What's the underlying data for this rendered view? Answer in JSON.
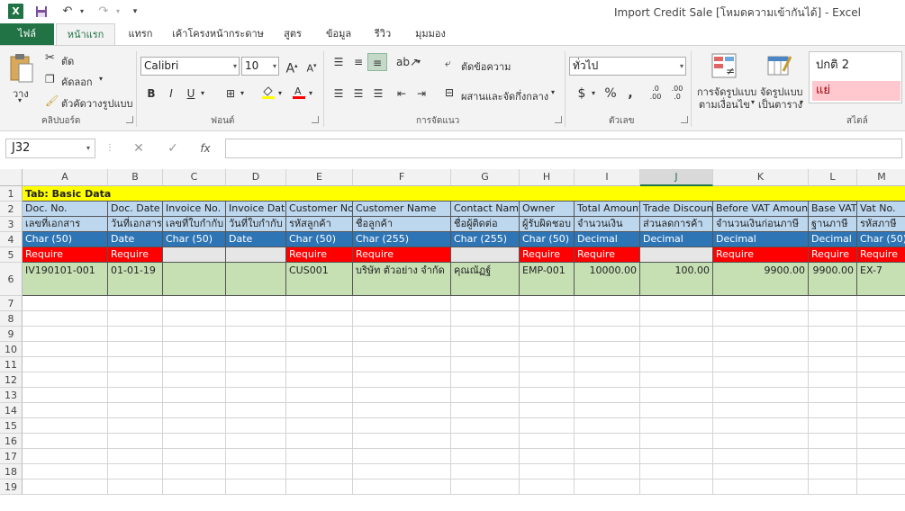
{
  "window": {
    "title": "Import Credit Sale  [โหมดความเข้ากันได้] - Excel",
    "app_icon": "X",
    "qa_save_icon": "save-icon",
    "qa_undo_icon": "undo-icon",
    "qa_redo_icon": "redo-icon"
  },
  "tabs": {
    "file": "ไฟล์",
    "items": [
      "หน้าแรก",
      "แทรก",
      "เค้าโครงหน้ากระดาษ",
      "สูตร",
      "ข้อมูล",
      "รีวิว",
      "มุมมอง"
    ]
  },
  "ribbon": {
    "clipboard": {
      "paste": "วาง",
      "cut": "ตัด",
      "copy": "คัดลอก",
      "format_painter": "ตัวคัดวางรูปแบบ",
      "label": "คลิปบอร์ด"
    },
    "font": {
      "name": "Calibri",
      "size": "10",
      "label": "ฟอนต์"
    },
    "alignment": {
      "wrap": "ตัดข้อความ",
      "merge": "ผสานและจัดกึ่งกลาง",
      "label": "การจัดแนว"
    },
    "number": {
      "format": "ทั่วไป",
      "label": "ตัวเลข"
    },
    "styles": {
      "conditional": "การจัดรูปแบบ",
      "conditional2": "ตามเงื่อนไข",
      "table": "จัดรูปแบบ",
      "table2": "เป็นตาราง",
      "normal": "ปกติ 2",
      "bad": "แย่",
      "label": "สไตล์"
    }
  },
  "formula_bar": {
    "name_box": "J32",
    "cancel": "✕",
    "enter": "✓",
    "fx": "fx",
    "value": ""
  },
  "sheet": {
    "columns": [
      "A",
      "B",
      "C",
      "D",
      "E",
      "F",
      "G",
      "H",
      "I",
      "J",
      "K",
      "L",
      "M"
    ],
    "selected_column": "J",
    "rows": [
      "1",
      "2",
      "3",
      "4",
      "5",
      "6",
      "7",
      "8",
      "9",
      "10",
      "11",
      "12",
      "13",
      "14",
      "15",
      "16",
      "17",
      "18",
      "19"
    ],
    "row1_title": "Tab: Basic Data",
    "header_en": [
      "Doc. No.",
      "Doc. Date",
      "Invoice No.",
      "Invoice Date",
      "Customer No",
      "Customer Name",
      "Contact Name",
      "Owner",
      "Total Amount",
      "Trade Discount",
      "Before VAT Amount",
      "Base VAT",
      "Vat No."
    ],
    "header_th": [
      "เลขที่เอกสาร",
      "วันที่เอกสาร",
      "เลขที่ใบกำกับ",
      "วันที่ใบกำกับ",
      "รหัสลูกค้า",
      "ชื่อลูกค้า",
      "ชื่อผู้ติดต่อ",
      "ผู้รับผิดชอบ",
      "จำนวนเงิน",
      "ส่วนลดการค้า",
      "จำนวนเงินก่อนภาษี",
      "ฐานภาษี",
      "รหัสภาษี"
    ],
    "types": [
      "Char (50)",
      "Date",
      "Char (50)",
      "Date",
      "Char (50)",
      "Char (255)",
      "Char (255)",
      "Char (50)",
      "Decimal",
      "Decimal",
      "Decimal",
      "Decimal",
      "Char (50)"
    ],
    "require": [
      "Require",
      "Require",
      "",
      "",
      "Require",
      "Require",
      "",
      "Require",
      "Require",
      "",
      "Require",
      "Require",
      "Require"
    ],
    "sample": [
      "IV190101-001",
      "01-01-19",
      "",
      "",
      "CUS001",
      "บริษัท ตัวอย่าง จำกัด",
      "คุณณัฏฐ์",
      "EMP-001",
      "10000.00",
      "100.00",
      "9900.00",
      "9900.00",
      "EX-7"
    ]
  },
  "colors": {
    "excel_green": "#217346",
    "title_row": "#ffff00",
    "header_light": "#bdd7ee",
    "type_row": "#2e75b6",
    "require_row": "#ff0000",
    "sample_row": "#c6e0b4",
    "empty_required": "#e7e6e6"
  }
}
